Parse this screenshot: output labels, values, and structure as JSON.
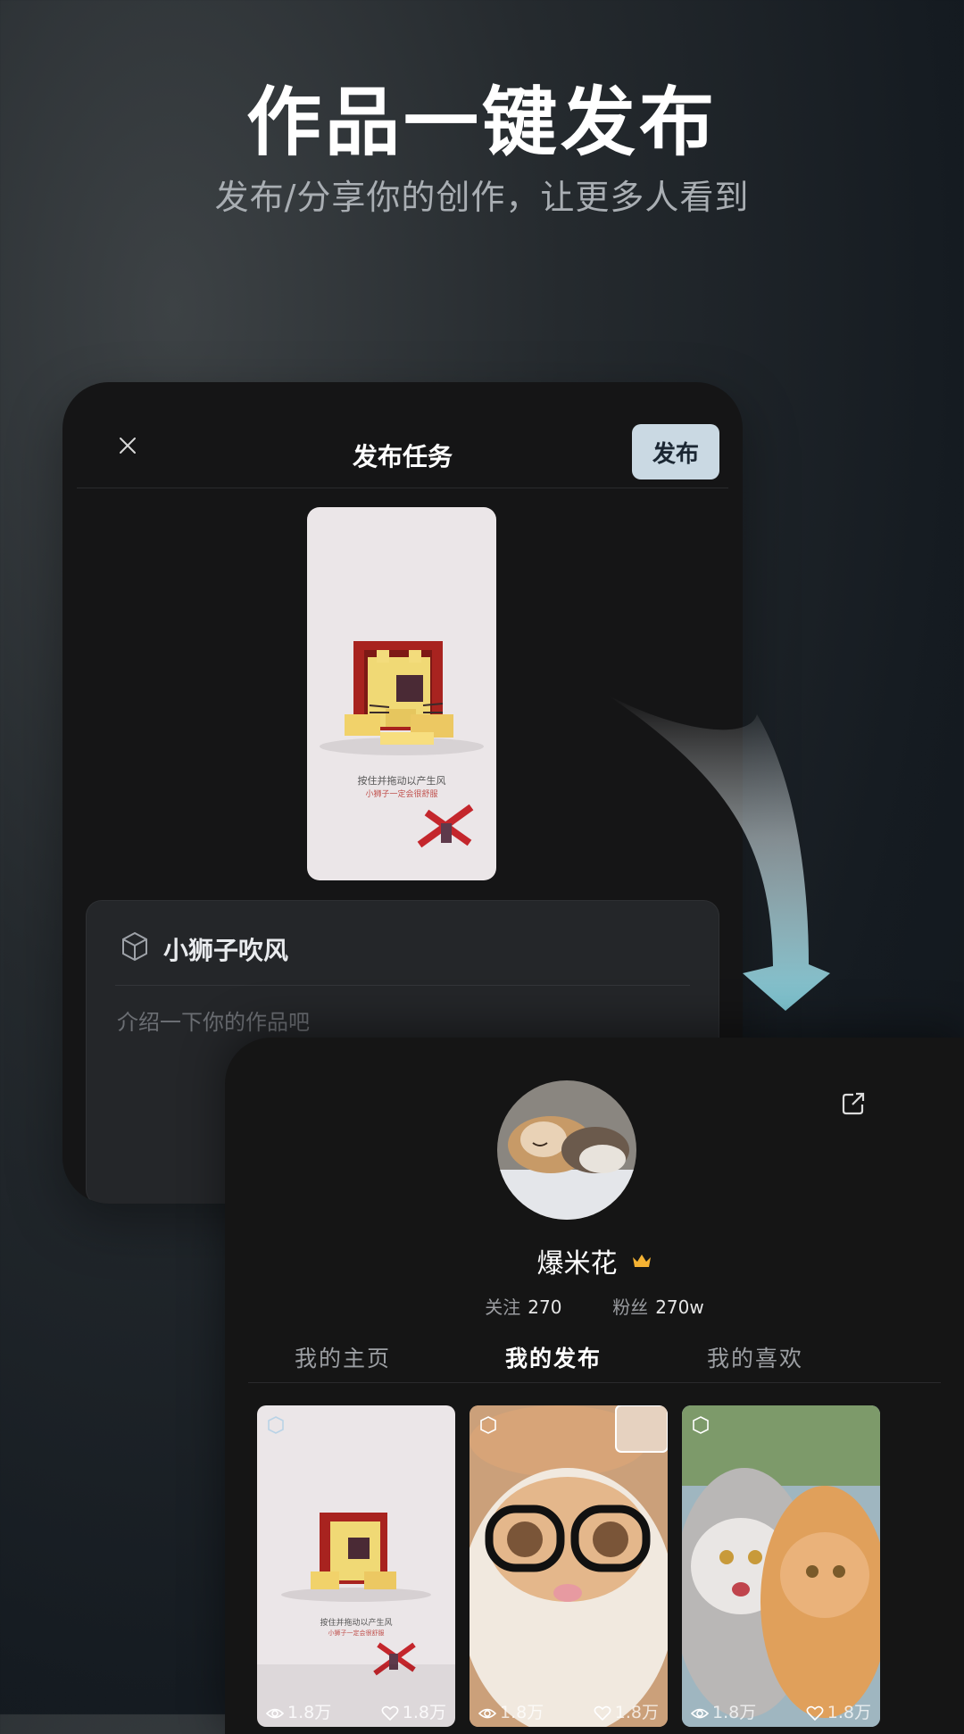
{
  "hero": {
    "title": "作品一键发布",
    "subtitle": "发布/分享你的创作，让更多人看到"
  },
  "publish_screen": {
    "title": "发布任务",
    "publish_label": "发布",
    "preview": {
      "hint": "按住并拖动以产生风",
      "sub_hint": "小狮子一定会很舒服"
    },
    "work_name": "小狮子吹风",
    "description_placeholder": "介绍一下你的作品吧"
  },
  "profile_screen": {
    "username": "爆米花",
    "following_label": "关注",
    "following_count": "270",
    "followers_label": "粉丝",
    "followers_count": "270w",
    "tabs": [
      "我的主页",
      "我的发布",
      "我的喜欢"
    ],
    "active_tab": "我的发布",
    "works": [
      {
        "views": "1.8万",
        "likes": "1.8万",
        "preview_hint": "按住并拖动以产生风",
        "preview_sub_hint": "小狮子一定会很舒服"
      },
      {
        "views": "1.8万",
        "likes": "1.8万"
      },
      {
        "views": "1.8万",
        "likes": "1.8万"
      }
    ]
  },
  "colors": {
    "accent_button": "#cad9e3",
    "card_bg": "#151516",
    "arrow_tip": "#7ec6d3"
  }
}
